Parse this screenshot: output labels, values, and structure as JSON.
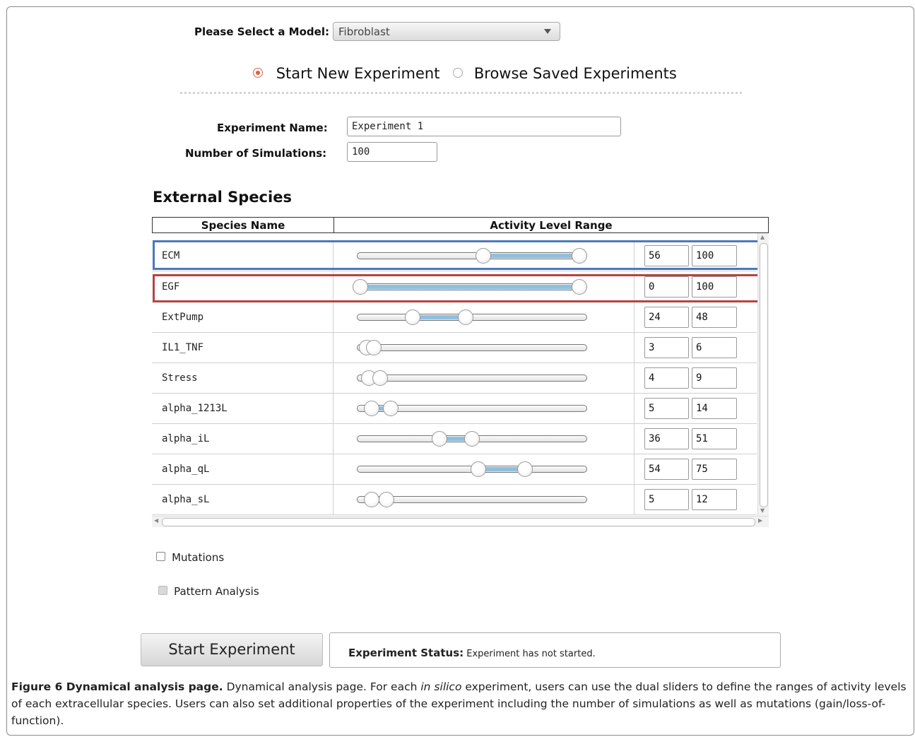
{
  "model": {
    "label": "Please Select a Model:",
    "selected": "Fibroblast"
  },
  "mode": {
    "option_new": "Start New Experiment",
    "option_browse": "Browse Saved Experiments",
    "selected": "new"
  },
  "form": {
    "name_label": "Experiment Name:",
    "name_value": "Experiment 1",
    "sims_label": "Number of Simulations:",
    "sims_value": "100"
  },
  "species_section": {
    "title": "External Species",
    "col_name": "Species Name",
    "col_range": "Activity Level Range",
    "rows": [
      {
        "name": "ECM",
        "min": "56",
        "max": "100",
        "fill_from": 0.56,
        "fill_to": 1.0
      },
      {
        "name": "EGF",
        "min": "0",
        "max": "100",
        "fill_from": 0.0,
        "fill_to": 1.0
      },
      {
        "name": "ExtPump",
        "min": "24",
        "max": "48",
        "fill_from": 0.24,
        "fill_to": 0.48
      },
      {
        "name": "IL1_TNF",
        "min": "3",
        "max": "6",
        "fill_from": 0.03,
        "fill_to": 0.06
      },
      {
        "name": "Stress",
        "min": "4",
        "max": "9",
        "fill_from": 0.04,
        "fill_to": 0.09
      },
      {
        "name": "alpha_1213L",
        "min": "5",
        "max": "14",
        "fill_from": 0.05,
        "fill_to": 0.14
      },
      {
        "name": "alpha_iL",
        "min": "36",
        "max": "51",
        "fill_from": 0.36,
        "fill_to": 0.51
      },
      {
        "name": "alpha_qL",
        "min": "54",
        "max": "75",
        "fill_from": 0.54,
        "fill_to": 0.75
      },
      {
        "name": "alpha_sL",
        "min": "5",
        "max": "12",
        "fill_from": 0.05,
        "fill_to": 0.12
      }
    ]
  },
  "options": {
    "mutations": "Mutations",
    "pattern": "Pattern Analysis"
  },
  "actions": {
    "start": "Start Experiment"
  },
  "status": {
    "label": "Experiment Status:",
    "value": "Experiment has not started."
  },
  "caption": {
    "figure": "Figure 6 Dynamical analysis page.",
    "text_a": " Dynamical analysis page. For each ",
    "italic": "in silico",
    "text_b": " experiment, users can use the dual sliders to define the ranges of activity levels of each extracellular species. Users can also set additional properties of the experiment including the number of simulations as well as mutations (gain/loss-of-function)."
  },
  "colors": {
    "highlight_ecm": "#4a7ab8",
    "highlight_egf": "#b5433f",
    "range_fill": "#8fbfdf",
    "radio_accent": "#e0603a"
  }
}
